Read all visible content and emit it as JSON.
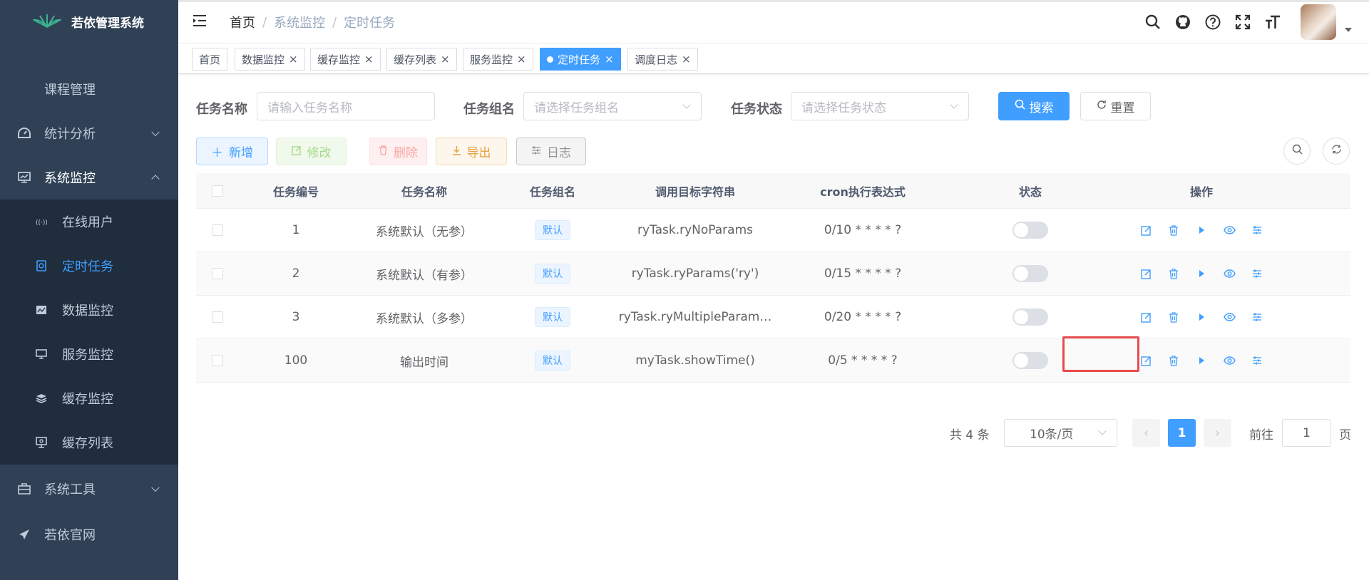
{
  "app": {
    "title": "若依管理系统"
  },
  "sidebar": {
    "items": [
      {
        "label": "课程管理"
      },
      {
        "label": "统计分析",
        "icon": "chart-icon"
      },
      {
        "label": "系统监控",
        "icon": "monitor-icon",
        "expanded": true
      },
      {
        "label": "系统工具",
        "icon": "toolbox-icon"
      },
      {
        "label": "若依官网",
        "icon": "send-icon"
      }
    ],
    "monitor_sub": [
      {
        "label": "在线用户",
        "icon": "online-icon"
      },
      {
        "label": "定时任务",
        "icon": "job-icon",
        "active": true
      },
      {
        "label": "数据监控",
        "icon": "druid-icon"
      },
      {
        "label": "服务监控",
        "icon": "server-icon"
      },
      {
        "label": "缓存监控",
        "icon": "redis-icon"
      },
      {
        "label": "缓存列表",
        "icon": "redis-list-icon"
      }
    ]
  },
  "breadcrumb": [
    "首页",
    "系统监控",
    "定时任务"
  ],
  "breadcrumb_sep": "/",
  "tags": [
    {
      "label": "首页"
    },
    {
      "label": "数据监控",
      "close": "×"
    },
    {
      "label": "缓存监控",
      "close": "×"
    },
    {
      "label": "缓存列表",
      "close": "×"
    },
    {
      "label": "服务监控",
      "close": "×"
    },
    {
      "label": "定时任务",
      "close": "×",
      "active": true
    },
    {
      "label": "调度日志",
      "close": "×"
    }
  ],
  "search": {
    "name_label": "任务名称",
    "name_placeholder": "请输入任务名称",
    "group_label": "任务组名",
    "group_placeholder": "请选择任务组名",
    "status_label": "任务状态",
    "status_placeholder": "请选择任务状态",
    "search_btn": "搜索",
    "reset_btn": "重置"
  },
  "toolbar": {
    "add": "新增",
    "edit": "修改",
    "delete": "删除",
    "export": "导出",
    "log": "日志"
  },
  "table": {
    "headers": [
      "任务编号",
      "任务名称",
      "任务组名",
      "调用目标字符串",
      "cron执行表达式",
      "状态",
      "操作"
    ],
    "rows": [
      {
        "id": "1",
        "name": "系统默认（无参）",
        "group": "默认",
        "target": "ryTask.ryNoParams",
        "cron": "0/10 * * * * ?",
        "status_on": false
      },
      {
        "id": "2",
        "name": "系统默认（有参）",
        "group": "默认",
        "target": "ryTask.ryParams('ry')",
        "cron": "0/15 * * * * ?",
        "status_on": false
      },
      {
        "id": "3",
        "name": "系统默认（多参）",
        "group": "默认",
        "target": "ryTask.ryMultipleParam…",
        "cron": "0/20 * * * * ?",
        "status_on": false
      },
      {
        "id": "100",
        "name": "输出时间",
        "group": "默认",
        "target": "myTask.showTime()",
        "cron": "0/5 * * * * ?",
        "status_on": false
      }
    ]
  },
  "pagination": {
    "total_text": "共 4 条",
    "page_size": "10条/页",
    "current_page": "1",
    "prev": "‹",
    "next": "›",
    "goto_label": "前往",
    "goto_value": "1",
    "page_suffix": "页"
  },
  "colors": {
    "primary": "#409eff",
    "sidebar_bg": "#304156",
    "submenu_bg": "#1f2d3d",
    "highlight": "#e74c4c"
  }
}
